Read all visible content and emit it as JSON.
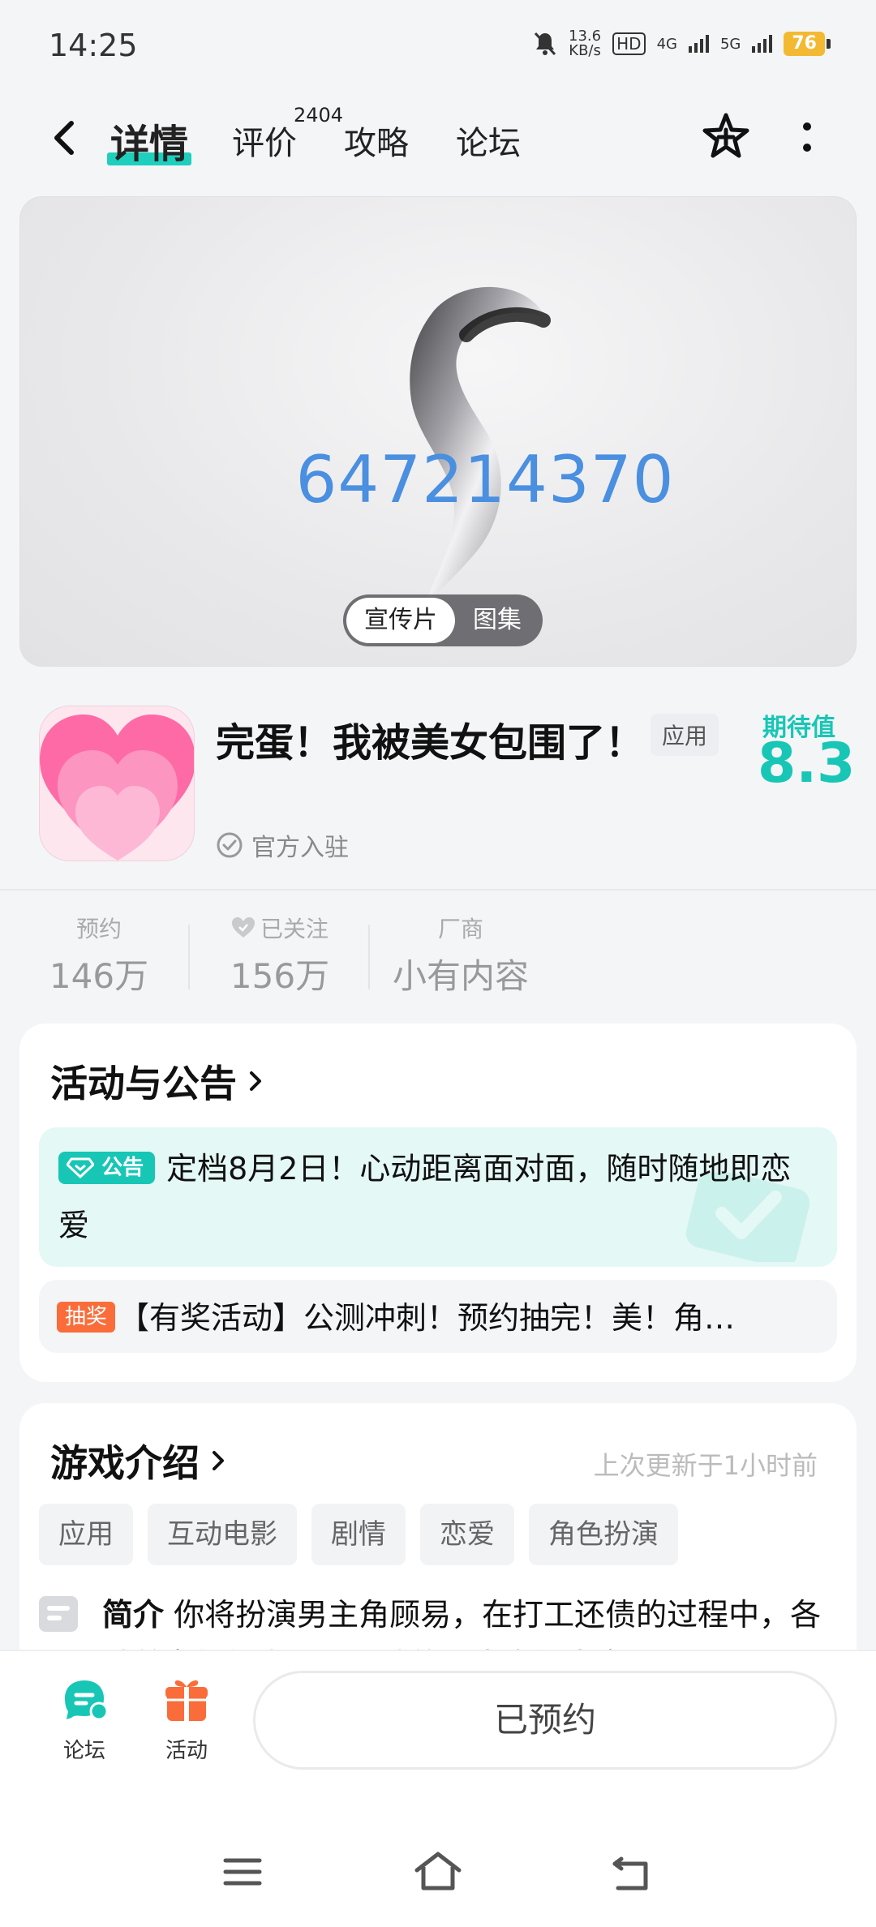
{
  "status_bar": {
    "time": "14:25",
    "net_speed_value": "13.6",
    "net_speed_unit": "KB/s",
    "hd_badge": "HD",
    "net_4g": "4G",
    "net_5g": "5G",
    "battery": "76"
  },
  "nav": {
    "tabs": [
      {
        "label": "详情",
        "active": true
      },
      {
        "label": "评价"
      },
      {
        "label": "攻略"
      },
      {
        "label": "论坛"
      }
    ],
    "review_count": "2404"
  },
  "banner": {
    "overlay_id": "647214370",
    "media_tabs": [
      "宣传片",
      "图集"
    ]
  },
  "app": {
    "title": "完蛋！我被美女包围了！",
    "type_badge": "应用",
    "expect_label": "期待值",
    "expect_value": "8.3",
    "official": "官方入驻"
  },
  "stats": [
    {
      "label": "预约",
      "value": "146万"
    },
    {
      "label": "已关注",
      "value": "156万"
    },
    {
      "label": "厂商",
      "value": "小有内容"
    }
  ],
  "activities": {
    "title": "活动与公告",
    "notice_tag": "公告",
    "notice_text": "定档8月2日！心动距离面对面，随时随地即恋爱",
    "lottery_tag": "抽奖",
    "lottery_text": "【有奖活动】公测冲刺！预约抽完！美！角…"
  },
  "intro": {
    "title": "游戏介绍",
    "updated": "上次更新于1小时前",
    "tags": [
      "应用",
      "互动电影",
      "剧情",
      "恋爱",
      "角色扮演"
    ],
    "label": "简介",
    "text": "你将扮演男主角顾易，在打工还债的过程中，各种美女纷纷出现，让他的人生变得丰富"
  },
  "bottom_bar": {
    "forum_label": "论坛",
    "activity_label": "活动",
    "reserve_label": "已预约"
  },
  "colors": {
    "accent": "#18c6b6",
    "lottery": "#fa6d3a",
    "banner_number": "#4a8fe0"
  }
}
